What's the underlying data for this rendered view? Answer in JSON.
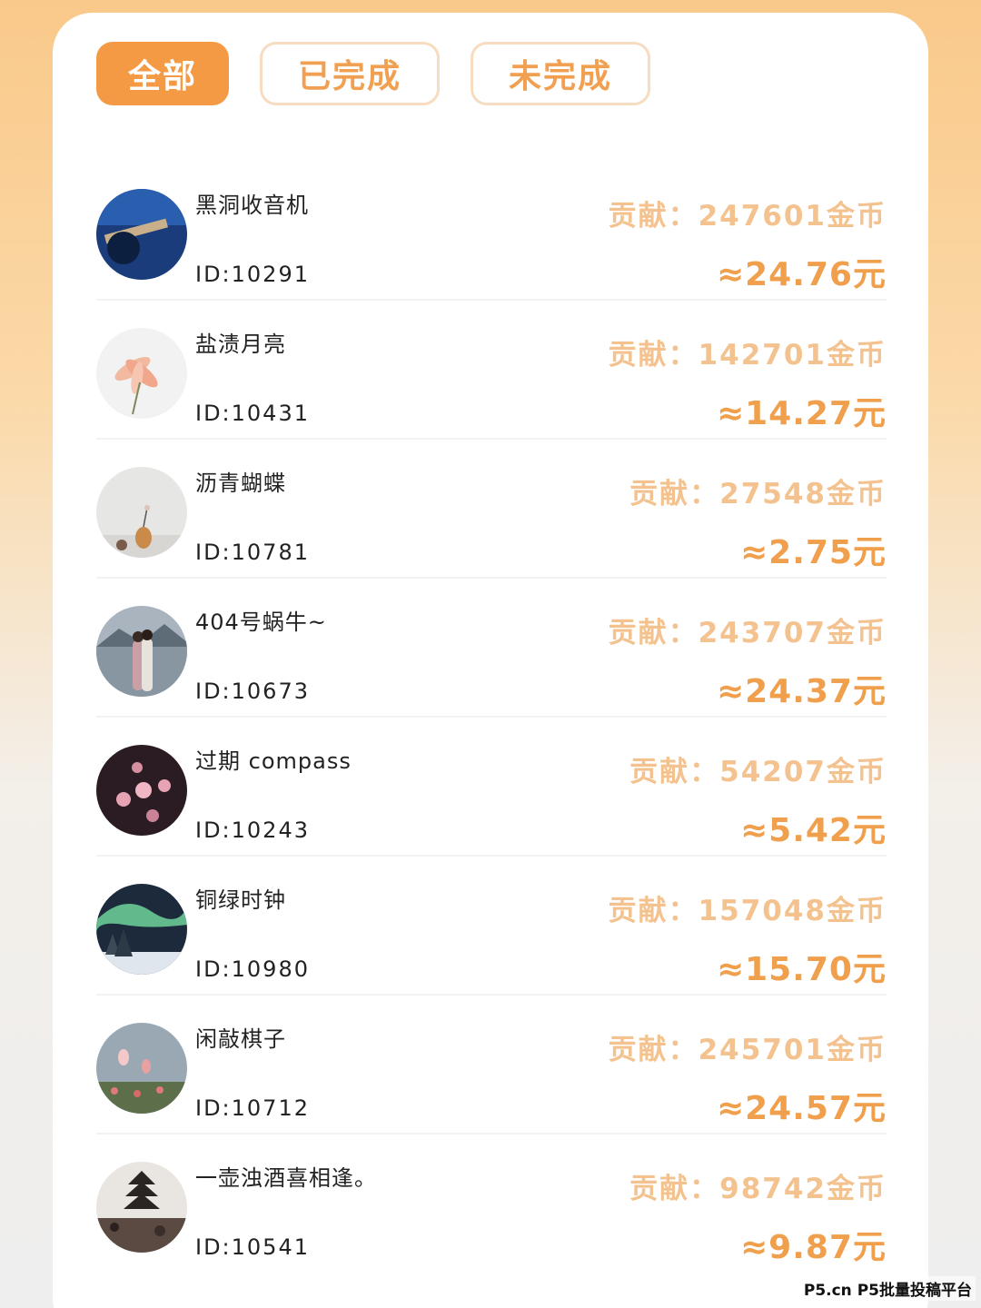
{
  "tabs": [
    {
      "label": "全部",
      "active": true
    },
    {
      "label": "已完成",
      "active": false
    },
    {
      "label": "未完成",
      "active": false
    }
  ],
  "contrib_prefix": "贡献：",
  "coin_unit": "金币",
  "amount_prefix": "≈",
  "amount_unit": "元",
  "members": [
    {
      "name": "黑洞收音机",
      "id": "ID:10291",
      "coins": "247601",
      "yuan": "24.76",
      "avatar": "guitar-photo"
    },
    {
      "name": "盐渍月亮",
      "id": "ID:10431",
      "coins": "142701",
      "yuan": "14.27",
      "avatar": "lily-flower-photo"
    },
    {
      "name": "沥青蝴蝶",
      "id": "ID:10781",
      "coins": "27548",
      "yuan": "2.75",
      "avatar": "vase-still-life-photo"
    },
    {
      "name": "404号蜗牛~",
      "id": "ID:10673",
      "coins": "243707",
      "yuan": "24.37",
      "avatar": "couple-lake-photo"
    },
    {
      "name": "过期 compass",
      "id": "ID:10243",
      "coins": "54207",
      "yuan": "5.42",
      "avatar": "pink-blossom-photo"
    },
    {
      "name": "铜绿时钟",
      "id": "ID:10980",
      "coins": "157048",
      "yuan": "15.70",
      "avatar": "aurora-photo"
    },
    {
      "name": "闲敲棋子",
      "id": "ID:10712",
      "coins": "245701",
      "yuan": "24.57",
      "avatar": "tulip-field-photo"
    },
    {
      "name": "一壶浊酒喜相逢。",
      "id": "ID:10541",
      "coins": "98742",
      "yuan": "9.87",
      "avatar": "pagoda-street-photo"
    }
  ],
  "watermark": "P5.cn P5批量投稿平台",
  "colors": {
    "accent": "#f49a45",
    "contrib_text": "#f3c28f",
    "amount_text": "#f0a04d"
  }
}
